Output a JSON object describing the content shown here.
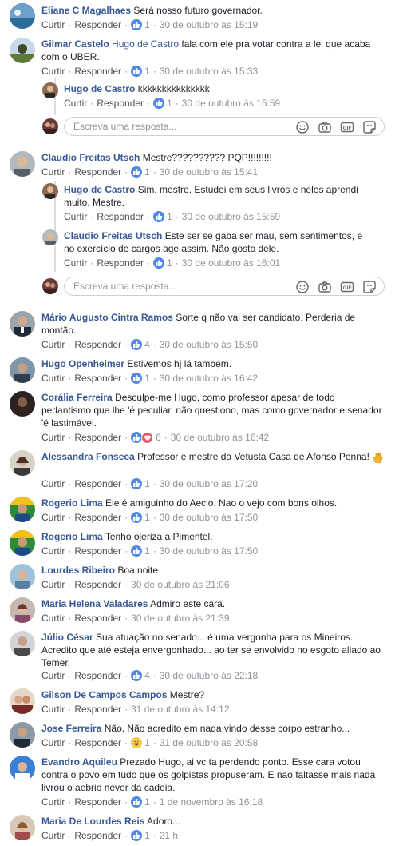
{
  "actions": {
    "like": "Curtir",
    "reply": "Responder",
    "separator": "·"
  },
  "reply_placeholder": "Escreva uma resposta...",
  "gif_label": "GIF",
  "colors": {
    "link": "#385898",
    "meta": "#90949c",
    "text": "#1d2129",
    "like_blue": "#4e88e8",
    "love_red": "#f25268"
  },
  "comments": [
    {
      "author": "Eliane C Magalhaes",
      "text": "Será nosso futuro governador.",
      "likes": "1",
      "time": "30 de outubro às 15:19"
    },
    {
      "author": "Gilmar Castelo",
      "mention": "Hugo de Castro",
      "text": " fala com ele pra votar contra a lei que acaba com o UBER.",
      "likes": "1",
      "time": "30 de outubro às 15:33",
      "replies": [
        {
          "author": "Hugo de Castro",
          "text": "kkkkkkkkkkkkkkk",
          "likes": "1",
          "time": "30 de outubro às 15:59"
        }
      ]
    },
    {
      "author": "Claudio Freitas Utsch",
      "text": "Mestre?????????? PQP!!!!!!!!!",
      "likes": "1",
      "time": "30 de outubro às 15:41",
      "replies": [
        {
          "author": "Hugo de Castro",
          "text": "Sim, mestre. Estudei em seus livros e neles aprendi muito. Mestre.",
          "likes": "1",
          "time": "30 de outubro às 15:59"
        },
        {
          "author": "Claudio Freitas Utsch",
          "text": "Este ser se gaba ser mau, sem sentimentos, e no exercício de cargos age assim. Não gosto dele.",
          "likes": "1",
          "time": "30 de outubro às 16:01"
        }
      ]
    },
    {
      "author": "Mário Augusto Cintra Ramos",
      "text": "Sorte q não vai ser candidato. Perderia de montão.",
      "likes": "4",
      "time": "30 de outubro às 15:50"
    },
    {
      "author": "Hugo Openheimer",
      "text": "Estivemos hj lá também.",
      "likes": "1",
      "time": "30 de outubro às 16:42"
    },
    {
      "author": "Corália Ferreira",
      "text": "Desculpe-me Hugo, como professor apesar de todo pedantismo que lhe 'é peculiar, não questiono, mas como governador e senador 'é lastimável.",
      "likes": "6",
      "time": "30 de outubro às 16:42"
    },
    {
      "author": "Alessandra Fonseca",
      "text": "Professor e mestre da Vetusta Casa de Afonso Penna!",
      "likes": "1",
      "time": "30 de outubro às 17:20"
    },
    {
      "author": "Rogerio Lima",
      "text": "Ele é amiguinho do Aecio. Nao o vejo com bons olhos.",
      "likes": "1",
      "time": "30 de outubro às 17:50"
    },
    {
      "author": "Rogerio Lima",
      "text": "Tenho ojeriza a Pimentel.",
      "likes": "1",
      "time": "30 de outubro às 17:50"
    },
    {
      "author": "Lourdes Ribeiro",
      "text": "Boa noite",
      "likes": "",
      "time": "30 de outubro às 21:06"
    },
    {
      "author": "Maria Helena Valadares",
      "text": "Admiro este cara.",
      "likes": "",
      "time": "30 de outubro às 21:39"
    },
    {
      "author": "Júlio César",
      "text": "Sua atuação no senado... é uma vergonha para os Mineiros. Acredito que até esteja envergonhado... ao ter se envolvido no esgoto aliado ao Temer.",
      "likes": "4",
      "time": "30 de outubro às 22:18"
    },
    {
      "author": "Gilson De Campos Campos",
      "text": "Mestre?",
      "likes": "",
      "time": "31 de outubro às 14:12"
    },
    {
      "author": "Jose Ferreira",
      "text": "Não. Não acredito em nada vindo desse corpo estranho...",
      "likes": "1",
      "time": "31 de outubro às 20:58"
    },
    {
      "author": "Evandro Aquileu",
      "text": "Prezado Hugo, ai vc ta perdendo ponto. Esse cara votou contra o povo em tudo que os golpistas propuseram. E nao faltasse mais nada livrou o aebrio never da cadeia.",
      "likes": "1",
      "time": "1 de novembro às 16:18"
    },
    {
      "author": "Maria De Lourdes Reis",
      "text": "Adoro...",
      "likes": "1",
      "time": "21 h"
    }
  ]
}
